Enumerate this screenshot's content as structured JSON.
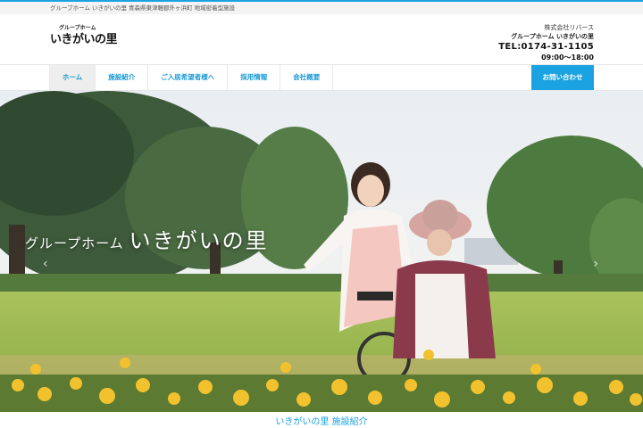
{
  "topbar": {
    "text": "グループホーム いきがいの里 青森県東津軽郡外ヶ浜町 地域密着型施設"
  },
  "logo": {
    "small": "グループホーム",
    "main": "いきがいの里"
  },
  "company": {
    "name": "株式会社リバース",
    "facility": "グループホーム いきがいの里",
    "tel": "TEL:0174-31-1105",
    "hours": "09:00～18:00"
  },
  "nav": {
    "items": [
      {
        "label": "ホーム"
      },
      {
        "label": "施設紹介"
      },
      {
        "label": "ご入居希望者様へ"
      },
      {
        "label": "採用情報"
      },
      {
        "label": "会社概要"
      }
    ],
    "contact": "お問い合わせ"
  },
  "hero": {
    "caption_small": "グループホーム",
    "caption_big": "いきがいの里",
    "prev": "‹",
    "next": "›"
  },
  "section": {
    "title": "いきがいの里 施設紹介"
  },
  "colors": {
    "accent": "#1aa3e0"
  }
}
